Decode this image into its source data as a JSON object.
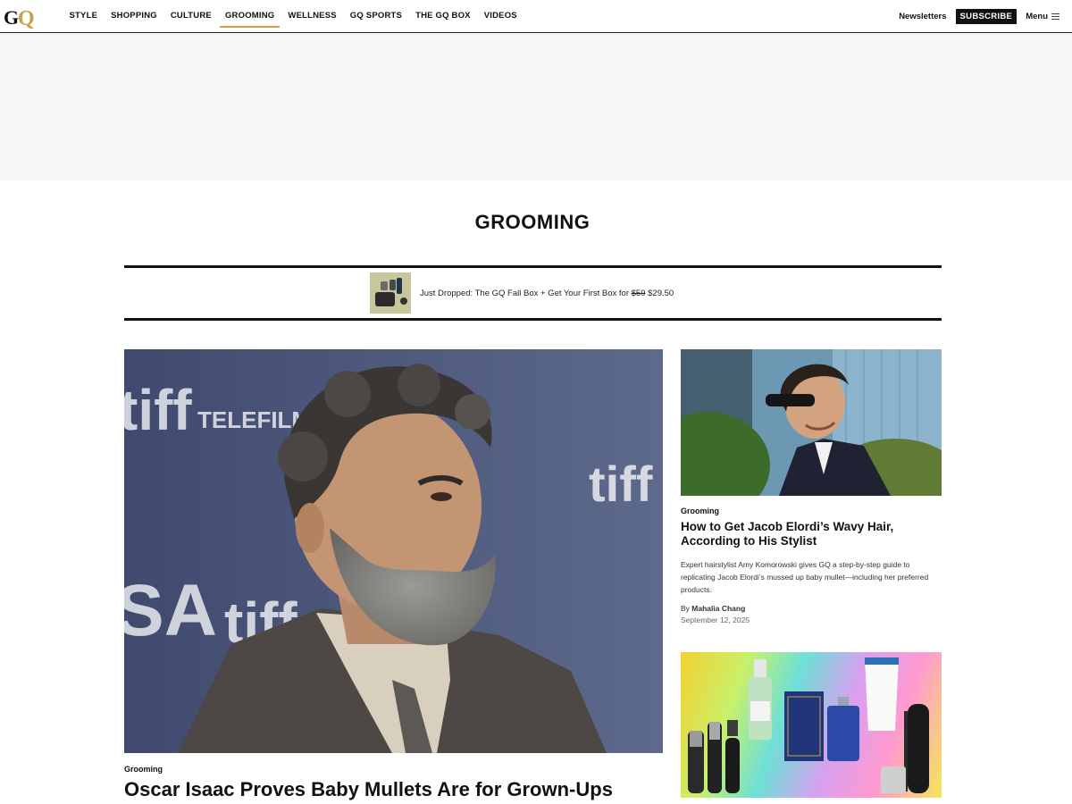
{
  "header": {
    "logo_text": "GQ",
    "nav": [
      "STYLE",
      "SHOPPING",
      "CULTURE",
      "GROOMING",
      "WELLNESS",
      "GQ SPORTS",
      "THE GQ BOX",
      "VIDEOS"
    ],
    "active_nav": "GROOMING",
    "newsletters": "Newsletters",
    "subscribe": "SUBSCRIBE",
    "menu": "Menu"
  },
  "page": {
    "title": "GROOMING"
  },
  "promo": {
    "text_before": "Just Dropped: The GQ Fall Box + Get Your First Box for ",
    "old_price": "$59",
    "new_price": "$29.50"
  },
  "hero": {
    "rubric": "Grooming",
    "headline": "Oscar Isaac Proves Baby Mullets Are for Grown-Ups",
    "backdrop_words": [
      "tiff",
      "TELEFILM",
      "SA",
      "tiff",
      "tiff"
    ]
  },
  "side_story": {
    "rubric": "Grooming",
    "headline": "How to Get Jacob Elordi’s Wavy Hair, According to His Stylist",
    "dek": "Expert hairstylist Amy Komorowski gives GQ a step-by-step guide to replicating Jacob Elordi’s mussed up baby mullet—including her preferred products.",
    "byline_prefix": "By ",
    "author": "Mahalia Chang",
    "date": "September 12, 2025"
  },
  "colors": {
    "accent_gold": "#c9a24a",
    "black": "#111111",
    "ad_band": "#f6f6f6"
  },
  "icons": [
    "menu-icon"
  ]
}
